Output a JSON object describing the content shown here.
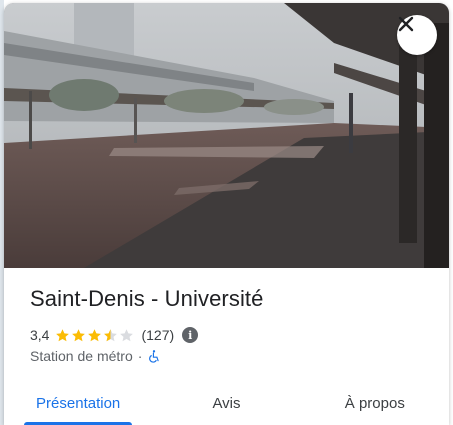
{
  "place": {
    "title": "Saint-Denis - Université",
    "rating": "3,4",
    "rating_fraction": 0.68,
    "review_count": "(127)",
    "info_icon_glyph": "i",
    "category": "Station de métro",
    "separator": "·",
    "accessibility_icon": "wheelchair-accessible-icon"
  },
  "photo": {
    "description_icon": "photo"
  },
  "close": {
    "icon": "close-icon"
  },
  "tabs": [
    {
      "label": "Présentation",
      "active": true
    },
    {
      "label": "Avis",
      "active": false
    },
    {
      "label": "À propos",
      "active": false
    }
  ],
  "colors": {
    "accent": "#1a73e8",
    "star": "#fbbc04",
    "star_empty": "#dadce0",
    "text_primary": "#202124",
    "text_secondary": "#5f6368"
  }
}
